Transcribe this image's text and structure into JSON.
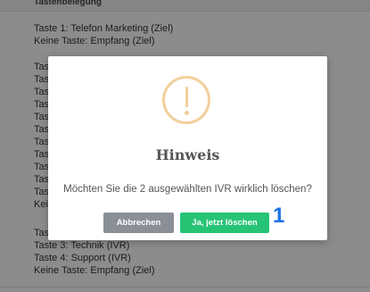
{
  "header": {
    "column_label": "Tastenbelegung"
  },
  "rows": {
    "section1": [
      "Taste 1: Telefon Marketing (Ziel)",
      "Keine Taste: Empfang (Ziel)"
    ],
    "section2": [
      "Tas",
      "Tas",
      "Tas",
      "Tas",
      "Tas",
      "Tas",
      "Tas",
      "Tas",
      "Tas",
      "Tas",
      "Tas",
      "Keir"
    ],
    "section3": [
      "Tas",
      "Taste 3: Technik (IVR)",
      "Taste 4: Support (IVR)",
      "Keine Taste: Empfang (Ziel)"
    ]
  },
  "dialog": {
    "icon": "warning-exclamation-icon",
    "title": "Hinweis",
    "message": "Möchten Sie die 2 ausgewählten IVR wirklich löschen?",
    "cancel_label": "Abbrechen",
    "confirm_label": "Ja, jetzt löschen"
  },
  "annotation": {
    "label": "1"
  },
  "colors": {
    "overlay": "#000000",
    "cancel_button": "#8b8f96",
    "confirm_button": "#27c475",
    "warning_icon": "#f2cf9b",
    "annotation": "#1a73e8"
  }
}
